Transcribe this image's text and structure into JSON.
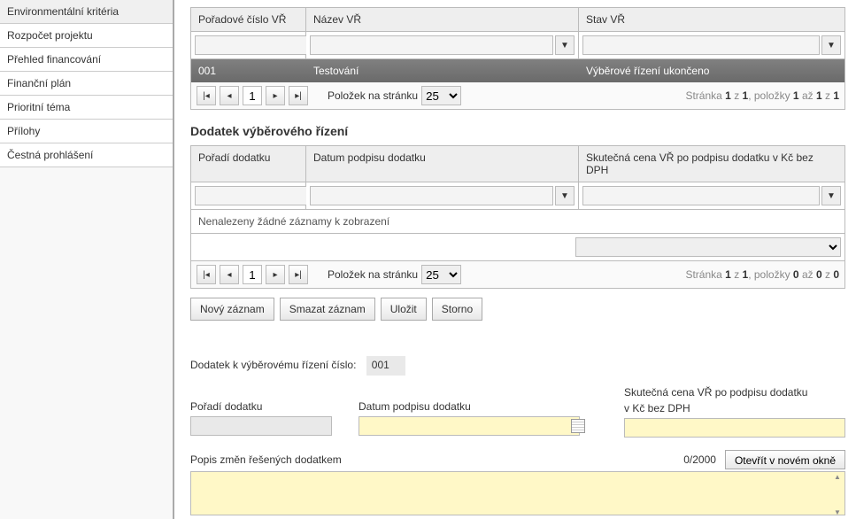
{
  "sidebar": {
    "items": [
      {
        "label": "Environmentální kritéria"
      },
      {
        "label": "Rozpočet projektu"
      },
      {
        "label": "Přehled financování"
      },
      {
        "label": "Finanční plán"
      },
      {
        "label": "Prioritní téma"
      },
      {
        "label": "Přílohy"
      },
      {
        "label": "Čestná prohlášení"
      }
    ]
  },
  "grid1": {
    "headers": {
      "c1": "Pořadové číslo VŘ",
      "c2": "Název VŘ",
      "c3": "Stav VŘ"
    },
    "rows": [
      {
        "c1": "001",
        "c2": "Testování",
        "c3": "Výběrové řízení ukončeno"
      }
    ],
    "pager": {
      "page": "1",
      "label": "Položek na stránku",
      "size": "25",
      "info_prefix": "Stránka ",
      "pages": "1",
      "of": " z ",
      "pages_total": "1",
      "items_prefix": ", položky ",
      "from": "1",
      "to_word": " až ",
      "to": "1",
      "of2": " z ",
      "total": "1"
    }
  },
  "section2_title": "Dodatek výběrového řízení",
  "grid2": {
    "headers": {
      "c1": "Pořadí dodatku",
      "c2": "Datum podpisu dodatku",
      "c3": "Skutečná cena VŘ po podpisu dodatku v Kč bez DPH"
    },
    "empty": "Nenalezeny žádné záznamy k zobrazení",
    "pager": {
      "page": "1",
      "label": "Položek na stránku",
      "size": "25",
      "info_prefix": "Stránka ",
      "pages": "1",
      "of": " z ",
      "pages_total": "1",
      "items_prefix": ", položky ",
      "from": "0",
      "to_word": " až ",
      "to": "0",
      "of2": " z ",
      "total": "0"
    }
  },
  "toolbar": {
    "new": "Nový záznam",
    "delete": "Smazat záznam",
    "save": "Uložit",
    "cancel": "Storno"
  },
  "form": {
    "title_label": "Dodatek k výběrovému řízení číslo:",
    "title_value": "001",
    "order_label": "Pořadí dodatku",
    "date_label": "Datum podpisu dodatku",
    "price_label_l1": "Skutečná cena VŘ po podpisu dodatku",
    "price_label_l2": "v Kč bez DPH",
    "desc_label": "Popis změn řešených dodatkem",
    "counter": "0/2000",
    "open": "Otevřít v novém okně"
  }
}
